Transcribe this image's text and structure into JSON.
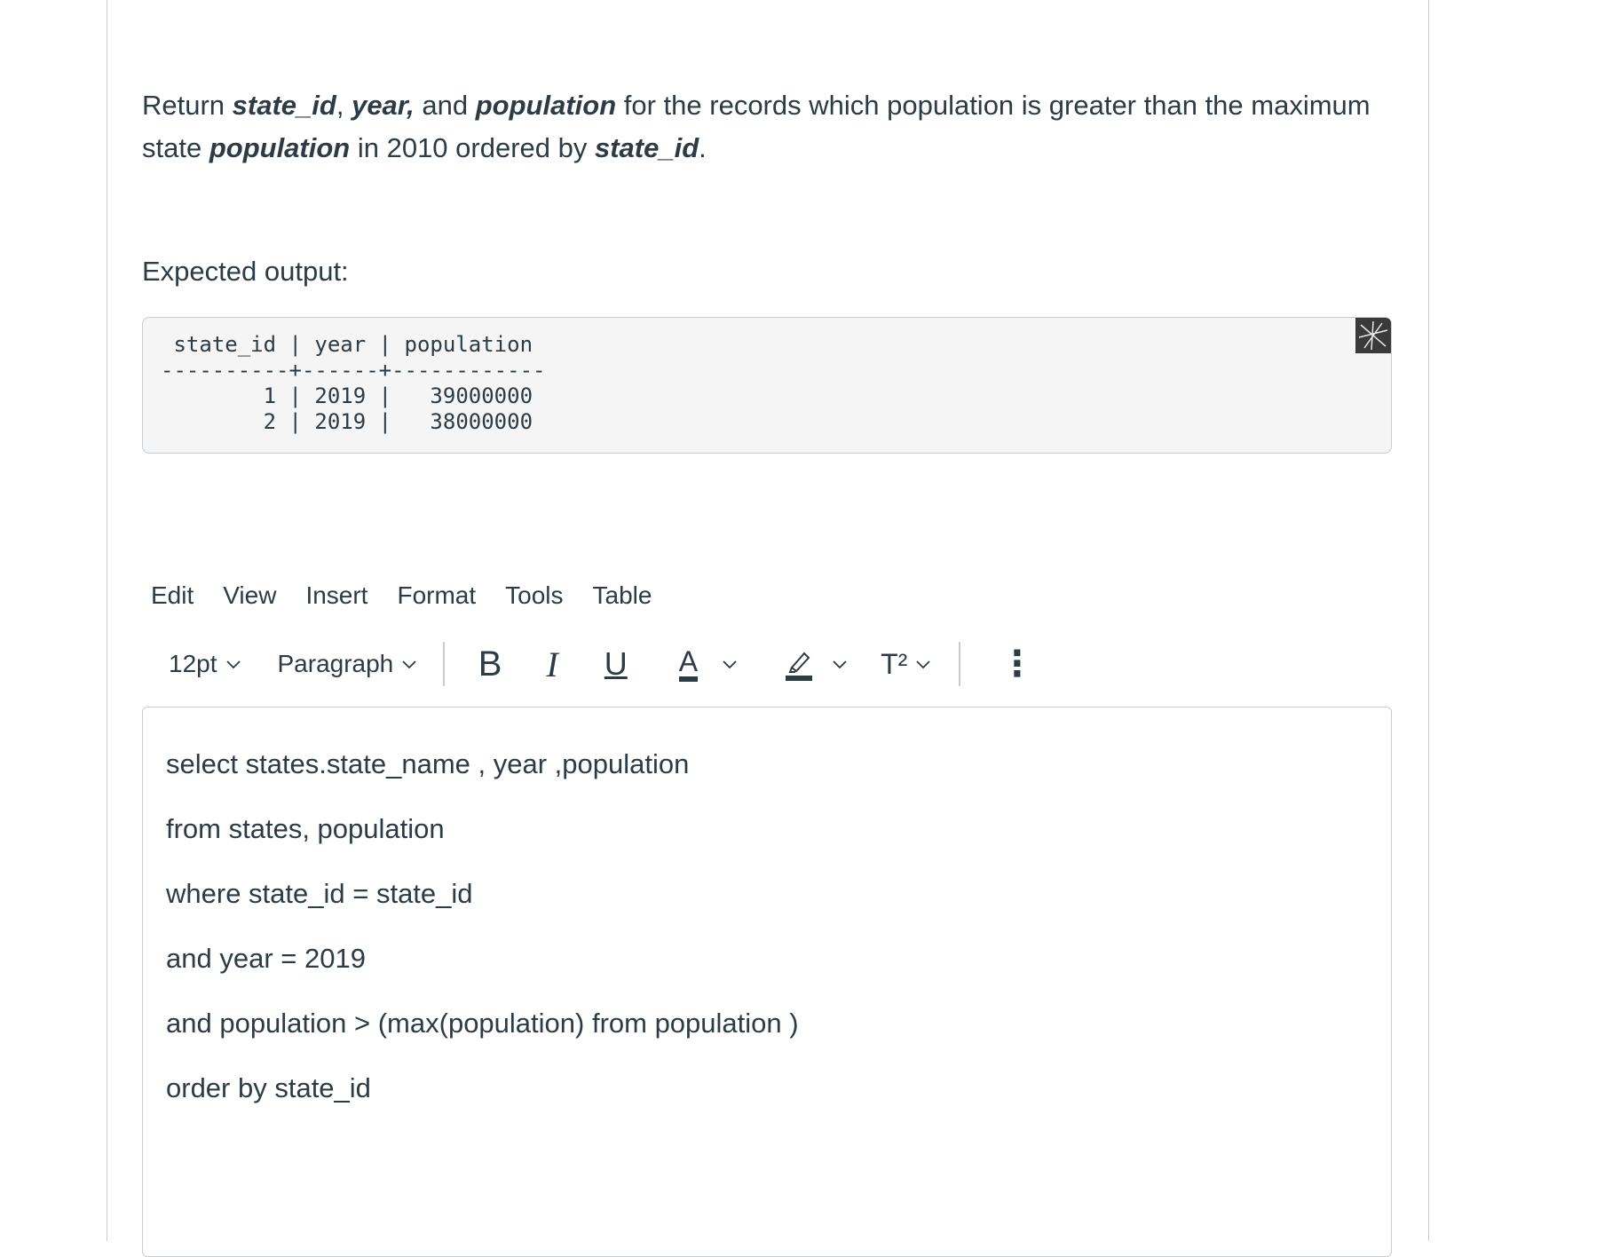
{
  "question": {
    "seg1": "Return ",
    "b1": "state_id",
    "seg2": ", ",
    "b2": "year,",
    "seg3": " and ",
    "b3": "population",
    "seg4": " for the records which population is greater than the maximum state ",
    "b4": "population",
    "seg5": " in 2010 ordered by ",
    "b5": "state_id",
    "seg6": "."
  },
  "expected_label": "Expected output:",
  "expected_output": " state_id | year | population\n----------+------+------------\n        1 | 2019 |   39000000\n        2 | 2019 |   38000000",
  "menu": [
    "Edit",
    "View",
    "Insert",
    "Format",
    "Tools",
    "Table"
  ],
  "toolbar": {
    "font_size": "12pt",
    "block_format": "Paragraph",
    "bold": "B",
    "italic": "I",
    "underline": "U",
    "text_color": "A",
    "superscript": "T²",
    "more": "⋮"
  },
  "editor": {
    "lines": [
      "select states.state_name , year ,population",
      "from states, population",
      "where state_id = state_id",
      "and year = 2019",
      "and population > (max(population) from population )",
      "order by state_id"
    ]
  },
  "colors": {
    "text": "#2d3b45",
    "border": "#c7cdd1",
    "code_bg": "#f5f5f5"
  }
}
